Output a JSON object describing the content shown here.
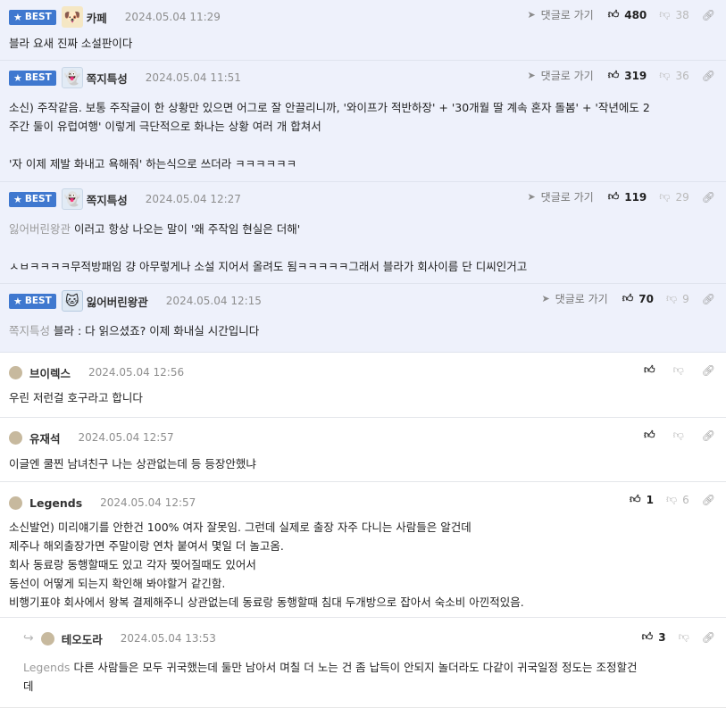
{
  "ui": {
    "best_label": "BEST",
    "reply_label": "댓글로 가기"
  },
  "comments": [
    {
      "best": true,
      "avatar_icon": "dog-avatar-icon",
      "author": "카페",
      "date": "2024.05.04 11:29",
      "likes": "480",
      "dislikes": "38",
      "lines": [
        "블라 요새 진짜 소설판이다"
      ]
    },
    {
      "best": true,
      "avatar_icon": "ghost-avatar-icon",
      "author": "쪽지특성",
      "date": "2024.05.04 11:51",
      "likes": "319",
      "dislikes": "36",
      "lines": [
        "소신) 주작같음. 보통 주작글이 한 상황만 있으면 어그로 잘 안끌리니까, '와이프가 적반하장' + '30개월 딸 계속 혼자 돌봄' + '작년에도 2",
        "주간 둘이 유럽여행' 이렇게 극단적으로 화나는 상황 여러 개 합쳐서",
        "",
        "'자 이제 제발 화내고 욕해줘' 하는식으로 쓰더라 ㅋㅋㅋㅋㅋㅋ"
      ]
    },
    {
      "best": true,
      "avatar_icon": "ghost-avatar-icon",
      "author": "쪽지특성",
      "date": "2024.05.04 12:27",
      "likes": "119",
      "dislikes": "29",
      "mention": "잃어버린왕관",
      "lines": [
        "이러고 항상 나오는 말이 '왜 주작임 현실은 더해'",
        "",
        "ㅅㅂㅋㅋㅋㅋ무적방패임 걍 아무렇게나 소설 지어서 올려도 됨ㅋㅋㅋㅋㅋ그래서 블라가 회사이름 단 디씨인거고"
      ]
    },
    {
      "best": true,
      "avatar_icon": "cat-avatar-icon",
      "author": "잃어버린왕관",
      "date": "2024.05.04 12:15",
      "likes": "70",
      "dislikes": "9",
      "mention": "쪽지특성",
      "lines": [
        "블라 : 다 읽으셨죠? 이제 화내실 시간입니다"
      ]
    },
    {
      "best": false,
      "author": "브이렉스",
      "date": "2024.05.04 12:56",
      "likes": "",
      "dislikes": "",
      "lines": [
        "우린 저런걸 호구라고 합니다"
      ]
    },
    {
      "best": false,
      "author": "유재석",
      "date": "2024.05.04 12:57",
      "likes": "",
      "dislikes": "",
      "lines": [
        "이글엔 쿨찐 남녀친구 나는 상관없는데 등 등장안했냐"
      ]
    },
    {
      "best": false,
      "author": "Legends",
      "date": "2024.05.04 12:57",
      "likes": "1",
      "dislikes": "6",
      "lines": [
        "소신발언) 미리얘기를 안한건 100% 여자 잘못임. 그런데 실제로 출장 자주 다니는 사람들은 알건데",
        "제주나 해외출장가면 주말이랑 연차 붙여서 몇일 더 놀고옴.",
        "회사 동료랑 동행할때도 있고 각자 찢어질때도 있어서",
        "동선이 어떻게 되는지 확인해 봐야할거 같긴함.",
        "비행기표야 회사에서 왕복 결제해주니 상관없는데 동료랑 동행할때 침대 두개방으로 잡아서 숙소비 아낀적있음."
      ]
    },
    {
      "best": false,
      "reply": true,
      "author": "테오도라",
      "date": "2024.05.04 13:53",
      "likes": "3",
      "dislikes": "",
      "mention": "Legends",
      "lines": [
        "다른 사람들은 모두 귀국했는데 둘만 남아서 며칠 더 노는 건 좀 납득이 안되지 놀더라도 다같이 귀국일정 정도는 조정할건",
        "데"
      ]
    }
  ]
}
